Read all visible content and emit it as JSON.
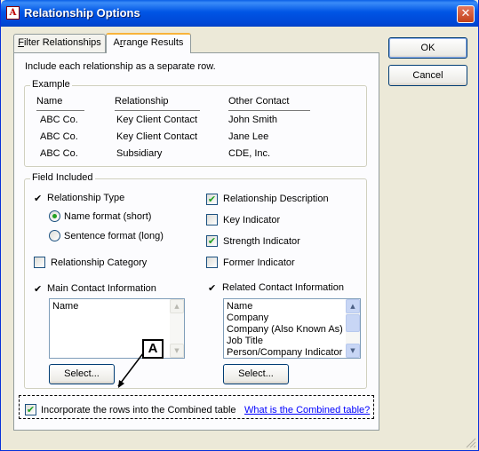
{
  "window": {
    "title": "Relationship Options",
    "close_glyph": "✕",
    "app_icon_glyph": "A"
  },
  "tabs": [
    {
      "label_first": "F",
      "label_rest": "ilter Relationships"
    },
    {
      "label_pre": "A",
      "label_u": "r",
      "label_post": "range Results"
    }
  ],
  "intro_text": "Include each relationship as a separate row.",
  "example": {
    "title": "Example",
    "headers": [
      "Name",
      "Relationship",
      "Other Contact"
    ],
    "rows": [
      [
        "ABC Co.",
        "Key Client Contact",
        "John Smith"
      ],
      [
        "ABC Co.",
        "Key Client Contact",
        "Jane Lee"
      ],
      [
        "ABC Co.",
        "Subsidiary",
        "CDE, Inc."
      ]
    ]
  },
  "field_included": {
    "title": "Field Included",
    "check_glyph": "✔",
    "relationship_type": {
      "label": "Relationship Type"
    },
    "name_format": {
      "label": "Name format (short)",
      "selected": true
    },
    "sentence_format": {
      "label": "Sentence format (long)",
      "selected": false
    },
    "relationship_category": {
      "label": "Relationship Category",
      "checked": false
    },
    "main_contact": {
      "label": "Main Contact Information"
    },
    "main_contact_list": [
      "Name"
    ],
    "relationship_description": {
      "label": "Relationship Description",
      "checked": true
    },
    "key_indicator": {
      "label": "Key Indicator",
      "checked": false
    },
    "strength_indicator": {
      "label": "Strength Indicator",
      "checked": true
    },
    "former_indicator": {
      "label": "Former Indicator",
      "checked": false
    },
    "related_contact": {
      "label": "Related Contact Information"
    },
    "related_contact_list": [
      "Name",
      "Company",
      "Company (Also Known As)",
      "Job Title",
      "Person/Company Indicator"
    ],
    "select_label": "Select...",
    "scroll_up_glyph": "▲",
    "scroll_down_glyph": "▼"
  },
  "incorporate": {
    "label": "Incorporate the rows into the Combined table",
    "checked": true,
    "link": "What is the Combined table?"
  },
  "callout": {
    "label": "A"
  },
  "buttons": {
    "ok": "OK",
    "cancel": "Cancel"
  }
}
